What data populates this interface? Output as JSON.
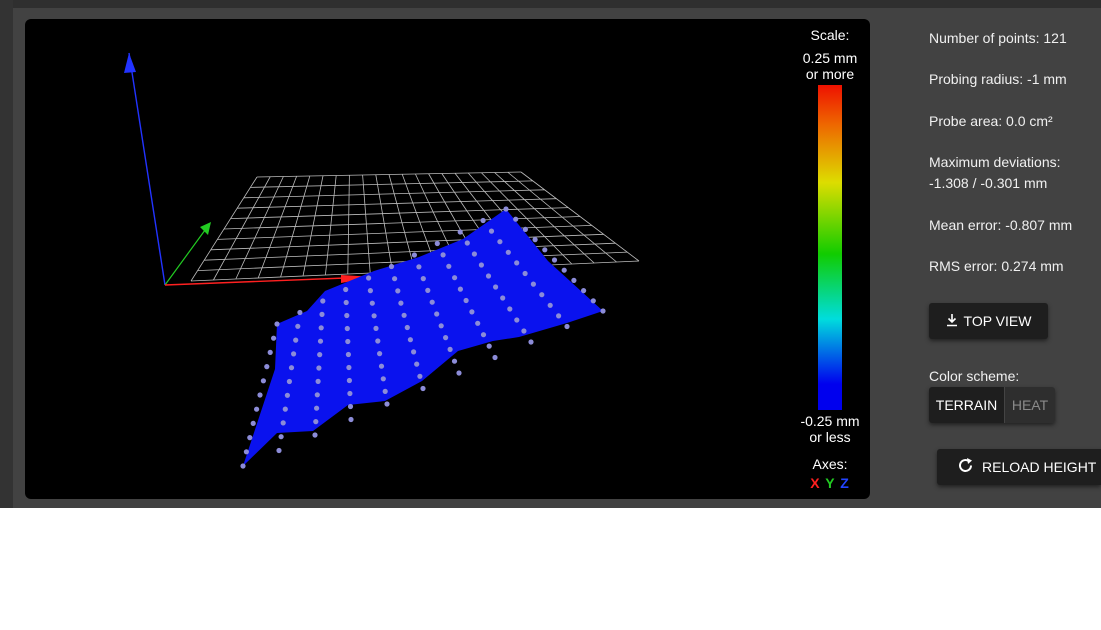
{
  "legend": {
    "scale_label": "Scale:",
    "max_line1": "0.25 mm",
    "max_line2": "or more",
    "min_line1": "-0.25 mm",
    "min_line2": "or less",
    "axes_label": "Axes:",
    "axis_x": "X",
    "axis_y": "Y",
    "axis_z": "Z",
    "colors": {
      "x": "#ff2020",
      "y": "#22cc22",
      "z": "#2244ff"
    }
  },
  "info": {
    "points": "Number of points: 121",
    "radius": "Probing radius: -1 mm",
    "area": "Probe area: 0.0 cm²",
    "max_dev_label": "Maximum deviations:",
    "max_dev_value": "-1.308 / -0.301 mm",
    "mean_error": "Mean error: -0.807 mm",
    "rms_error": "RMS error: 0.274 mm"
  },
  "buttons": {
    "top_view": "TOP VIEW",
    "top_view_icon": "download-arrow-icon",
    "color_scheme_label": "Color scheme:",
    "terrain": "TERRAIN",
    "heat": "HEAT",
    "reload": "RELOAD HEIGHT M",
    "reload_icon": "refresh-icon"
  }
}
